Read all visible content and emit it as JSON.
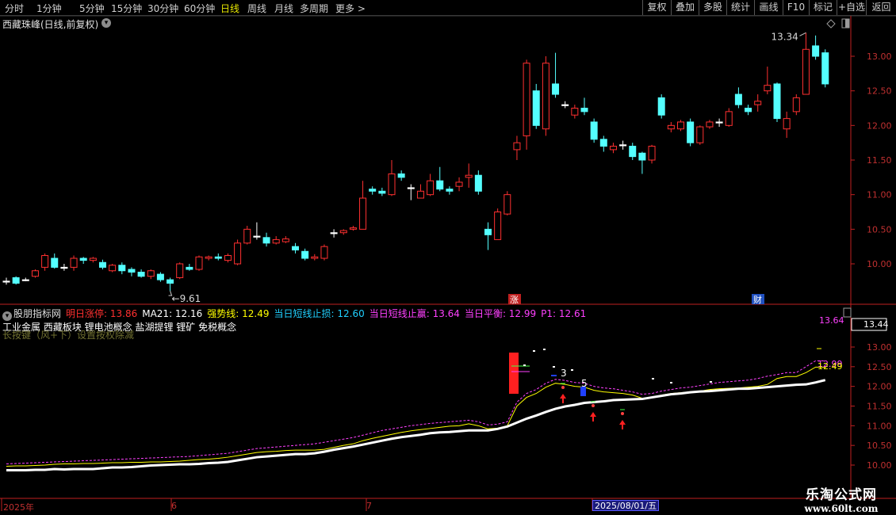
{
  "toolbar": {
    "periods": [
      "分时",
      "1分钟",
      "5分钟",
      "15分钟",
      "30分钟",
      "60分钟",
      "日线",
      "周线",
      "月线",
      "多周期",
      "更多 >"
    ],
    "active_period": "日线",
    "right_buttons": [
      "复权",
      "叠加",
      "多股",
      "统计",
      "画线",
      "F10",
      "标记",
      "+自选",
      "返回"
    ]
  },
  "main_panel": {
    "title": "西藏珠峰(日线,前复权)",
    "y_ticks": [
      "13.00",
      "12.50",
      "12.00",
      "11.50",
      "11.00",
      "10.50",
      "10.00"
    ],
    "high_label": "13.34",
    "low_label": "9.61",
    "event_badges": [
      {
        "text": "涨",
        "color": "#c02020"
      },
      {
        "text": "财",
        "color": "#2050c0"
      }
    ]
  },
  "indicator_panel": {
    "name": "股朋指标网",
    "items": [
      {
        "label": "明日涨停: 13.86",
        "color": "#ff3030"
      },
      {
        "label": "MA21: 12.16",
        "color": "#ffffff"
      },
      {
        "label": "强势线: 12.49",
        "color": "#ffff00"
      },
      {
        "label": "当日短线止损: 12.60",
        "color": "#20d0ff"
      },
      {
        "label": "当日短线止赢: 13.64",
        "color": "#ff40ff"
      },
      {
        "label": "当日平衡: 12.99",
        "color": "#ff40ff"
      },
      {
        "label": "P1: 12.61",
        "color": "#ff40ff"
      }
    ],
    "concept": "工业金属 西藏板块 锂电池概念 盐湖提锂 锂矿 免税概念",
    "ghost_text": "长按键（风+下）设置按权除减",
    "y_ticks": [
      "13.00",
      "12.50",
      "12.00",
      "11.50",
      "11.00",
      "10.50",
      "10.00"
    ],
    "right_labels": [
      {
        "text": "13.64",
        "color": "#ff40ff"
      },
      {
        "text": "13.44",
        "color": "#ffffff"
      },
      {
        "text": "12.99",
        "color": "#ff40ff"
      },
      {
        "text": "12.49",
        "color": "#ffff00"
      }
    ],
    "markers": [
      "3",
      "5"
    ]
  },
  "time_axis": {
    "labels": [
      "2025年",
      "6",
      "7"
    ],
    "cursor_date": "2025/08/01/五"
  },
  "watermark": {
    "title": "乐淘公式网",
    "url": "www.60lt.com"
  },
  "colors": {
    "up": "#ff3030",
    "down": "#54ffff",
    "axis": "#c02020",
    "ma": "#ffffff",
    "strong_line": "#ffff00",
    "upper_band": "#ff40ff"
  },
  "chart_data": {
    "type": "candlestick",
    "price_range": [
      9.61,
      13.34
    ],
    "ylim_main": [
      9.7,
      13.2
    ],
    "ylim_indicator": [
      9.9,
      13.2
    ],
    "x_labels": [
      "2025年",
      "6",
      "7",
      "2025/08/01/五"
    ],
    "candles": [
      {
        "o": 9.75,
        "c": 9.75,
        "h": 9.8,
        "l": 9.7
      },
      {
        "o": 9.8,
        "c": 9.72,
        "h": 9.82,
        "l": 9.7
      },
      {
        "o": 9.77,
        "c": 9.77,
        "h": 9.8,
        "l": 9.75
      },
      {
        "o": 9.82,
        "c": 9.9,
        "h": 9.92,
        "l": 9.8
      },
      {
        "o": 9.95,
        "c": 10.12,
        "h": 10.15,
        "l": 9.9
      },
      {
        "o": 10.08,
        "c": 9.95,
        "h": 10.15,
        "l": 9.93
      },
      {
        "o": 9.95,
        "c": 9.95,
        "h": 10.0,
        "l": 9.9
      },
      {
        "o": 9.95,
        "c": 10.08,
        "h": 10.12,
        "l": 9.9
      },
      {
        "o": 10.08,
        "c": 10.05,
        "h": 10.1,
        "l": 10.0
      },
      {
        "o": 10.05,
        "c": 10.08,
        "h": 10.1,
        "l": 10.02
      },
      {
        "o": 10.02,
        "c": 9.95,
        "h": 10.06,
        "l": 9.92
      },
      {
        "o": 9.9,
        "c": 9.98,
        "h": 10.0,
        "l": 9.88
      },
      {
        "o": 9.98,
        "c": 9.9,
        "h": 10.02,
        "l": 9.85
      },
      {
        "o": 9.92,
        "c": 9.88,
        "h": 9.95,
        "l": 9.82
      },
      {
        "o": 9.88,
        "c": 9.82,
        "h": 9.92,
        "l": 9.8
      },
      {
        "o": 9.82,
        "c": 9.9,
        "h": 9.92,
        "l": 9.78
      },
      {
        "o": 9.85,
        "c": 9.77,
        "h": 9.88,
        "l": 9.74
      },
      {
        "o": 9.77,
        "c": 9.72,
        "h": 9.8,
        "l": 9.61
      },
      {
        "o": 9.8,
        "c": 10.0,
        "h": 10.02,
        "l": 9.78
      },
      {
        "o": 9.95,
        "c": 9.92,
        "h": 10.0,
        "l": 9.9
      },
      {
        "o": 9.92,
        "c": 10.1,
        "h": 10.12,
        "l": 9.9
      },
      {
        "o": 10.08,
        "c": 10.1,
        "h": 10.12,
        "l": 10.05
      },
      {
        "o": 10.1,
        "c": 10.08,
        "h": 10.15,
        "l": 10.05
      },
      {
        "o": 10.05,
        "c": 10.12,
        "h": 10.15,
        "l": 10.02
      },
      {
        "o": 10.0,
        "c": 10.3,
        "h": 10.35,
        "l": 9.98
      },
      {
        "o": 10.3,
        "c": 10.5,
        "h": 10.55,
        "l": 10.28
      },
      {
        "o": 10.4,
        "c": 10.4,
        "h": 10.6,
        "l": 10.35
      },
      {
        "o": 10.38,
        "c": 10.3,
        "h": 10.45,
        "l": 10.25
      },
      {
        "o": 10.3,
        "c": 10.35,
        "h": 10.4,
        "l": 10.28
      },
      {
        "o": 10.32,
        "c": 10.36,
        "h": 10.4,
        "l": 10.3
      },
      {
        "o": 10.25,
        "c": 10.2,
        "h": 10.3,
        "l": 10.15
      },
      {
        "o": 10.18,
        "c": 10.08,
        "h": 10.22,
        "l": 10.05
      },
      {
        "o": 10.08,
        "c": 10.1,
        "h": 10.14,
        "l": 10.05
      },
      {
        "o": 10.08,
        "c": 10.25,
        "h": 10.28,
        "l": 10.05
      },
      {
        "o": 10.45,
        "c": 10.45,
        "h": 10.5,
        "l": 10.38
      },
      {
        "o": 10.45,
        "c": 10.48,
        "h": 10.5,
        "l": 10.42
      },
      {
        "o": 10.5,
        "c": 10.52,
        "h": 10.55,
        "l": 10.48
      },
      {
        "o": 10.5,
        "c": 10.95,
        "h": 11.2,
        "l": 10.5
      },
      {
        "o": 11.08,
        "c": 11.05,
        "h": 11.12,
        "l": 11.0
      },
      {
        "o": 11.05,
        "c": 11.02,
        "h": 11.1,
        "l": 10.98
      },
      {
        "o": 11.0,
        "c": 11.3,
        "h": 11.5,
        "l": 10.98
      },
      {
        "o": 11.3,
        "c": 11.25,
        "h": 11.35,
        "l": 11.2
      },
      {
        "o": 11.1,
        "c": 11.1,
        "h": 11.15,
        "l": 10.92
      },
      {
        "o": 10.95,
        "c": 11.05,
        "h": 11.15,
        "l": 10.95
      },
      {
        "o": 11.0,
        "c": 11.2,
        "h": 11.3,
        "l": 10.98
      },
      {
        "o": 11.2,
        "c": 11.08,
        "h": 11.4,
        "l": 11.05
      },
      {
        "o": 11.08,
        "c": 11.05,
        "h": 11.12,
        "l": 11.0
      },
      {
        "o": 11.12,
        "c": 11.18,
        "h": 11.25,
        "l": 11.05
      },
      {
        "o": 11.25,
        "c": 11.28,
        "h": 11.45,
        "l": 11.1
      },
      {
        "o": 11.28,
        "c": 11.05,
        "h": 11.35,
        "l": 11.0
      },
      {
        "o": 10.5,
        "c": 10.42,
        "h": 10.6,
        "l": 10.2
      },
      {
        "o": 10.35,
        "c": 10.75,
        "h": 10.8,
        "l": 10.35
      },
      {
        "o": 10.72,
        "c": 11.0,
        "h": 11.05,
        "l": 10.7
      },
      {
        "o": 11.65,
        "c": 11.75,
        "h": 11.85,
        "l": 11.5
      },
      {
        "o": 11.85,
        "c": 12.9,
        "h": 12.95,
        "l": 11.65
      },
      {
        "o": 12.5,
        "c": 12.0,
        "h": 12.6,
        "l": 11.95
      },
      {
        "o": 11.95,
        "c": 12.9,
        "h": 13.0,
        "l": 11.85
      },
      {
        "o": 12.6,
        "c": 12.45,
        "h": 13.05,
        "l": 12.4
      },
      {
        "o": 12.3,
        "c": 12.3,
        "h": 12.35,
        "l": 12.25
      },
      {
        "o": 12.15,
        "c": 12.25,
        "h": 12.3,
        "l": 12.1
      },
      {
        "o": 12.25,
        "c": 12.2,
        "h": 12.4,
        "l": 12.15
      },
      {
        "o": 12.05,
        "c": 11.8,
        "h": 12.1,
        "l": 11.75
      },
      {
        "o": 11.8,
        "c": 11.7,
        "h": 11.85,
        "l": 11.62
      },
      {
        "o": 11.65,
        "c": 11.7,
        "h": 11.75,
        "l": 11.6
      },
      {
        "o": 11.72,
        "c": 11.72,
        "h": 11.78,
        "l": 11.65
      },
      {
        "o": 11.7,
        "c": 11.55,
        "h": 11.75,
        "l": 11.5
      },
      {
        "o": 11.6,
        "c": 11.5,
        "h": 11.62,
        "l": 11.3
      },
      {
        "o": 11.5,
        "c": 11.7,
        "h": 11.72,
        "l": 11.45
      },
      {
        "o": 12.4,
        "c": 12.15,
        "h": 12.45,
        "l": 12.1
      },
      {
        "o": 11.95,
        "c": 12.0,
        "h": 12.05,
        "l": 11.9
      },
      {
        "o": 11.95,
        "c": 12.05,
        "h": 12.08,
        "l": 11.92
      },
      {
        "o": 12.05,
        "c": 11.75,
        "h": 12.1,
        "l": 11.7
      },
      {
        "o": 11.75,
        "c": 11.98,
        "h": 12.0,
        "l": 11.72
      },
      {
        "o": 11.98,
        "c": 12.05,
        "h": 12.08,
        "l": 11.95
      },
      {
        "o": 12.05,
        "c": 12.05,
        "h": 12.1,
        "l": 11.98
      },
      {
        "o": 12.0,
        "c": 12.2,
        "h": 12.25,
        "l": 11.98
      },
      {
        "o": 12.45,
        "c": 12.3,
        "h": 12.55,
        "l": 12.25
      },
      {
        "o": 12.25,
        "c": 12.2,
        "h": 12.3,
        "l": 12.15
      },
      {
        "o": 12.3,
        "c": 12.35,
        "h": 12.45,
        "l": 12.2
      },
      {
        "o": 12.5,
        "c": 12.58,
        "h": 12.85,
        "l": 12.45
      },
      {
        "o": 12.6,
        "c": 12.1,
        "h": 12.62,
        "l": 12.05
      },
      {
        "o": 11.95,
        "c": 12.1,
        "h": 12.2,
        "l": 11.82
      },
      {
        "o": 12.2,
        "c": 12.4,
        "h": 12.45,
        "l": 12.15
      },
      {
        "o": 12.45,
        "c": 13.1,
        "h": 13.34,
        "l": 12.45
      },
      {
        "o": 13.15,
        "c": 13.0,
        "h": 13.3,
        "l": 12.95
      },
      {
        "o": 13.05,
        "c": 12.6,
        "h": 13.1,
        "l": 12.55
      }
    ],
    "ma21": [
      9.87,
      9.87,
      9.87,
      9.88,
      9.88,
      9.9,
      9.89,
      9.9,
      9.9,
      9.9,
      9.92,
      9.94,
      9.94,
      9.95,
      9.97,
      9.99,
      10.0,
      10.01,
      10.02,
      10.02,
      10.03,
      10.05,
      10.06,
      10.08,
      10.12,
      10.16,
      10.2,
      10.22,
      10.24,
      10.26,
      10.28,
      10.28,
      10.3,
      10.34,
      10.39,
      10.43,
      10.47,
      10.52,
      10.57,
      10.62,
      10.67,
      10.71,
      10.74,
      10.77,
      10.81,
      10.83,
      10.84,
      10.86,
      10.88,
      10.88,
      10.88,
      10.92,
      10.98,
      11.08,
      11.18,
      11.26,
      11.35,
      11.43,
      11.49,
      11.53,
      11.58,
      11.6,
      11.62,
      11.65,
      11.66,
      11.67,
      11.68,
      11.72,
      11.76,
      11.8,
      11.82,
      11.85,
      11.87,
      11.88,
      11.9,
      11.92,
      11.94,
      11.94,
      11.96,
      11.98,
      12.0,
      12.02,
      12.04,
      12.05,
      12.1,
      12.16
    ],
    "strong_line": [
      9.97,
      9.98,
      9.98,
      9.99,
      10.0,
      10.02,
      10.03,
      10.03,
      10.04,
      10.04,
      10.05,
      10.06,
      10.06,
      10.07,
      10.07,
      10.08,
      10.08,
      10.09,
      10.1,
      10.12,
      10.14,
      10.15,
      10.17,
      10.2,
      10.24,
      10.28,
      10.32,
      10.34,
      10.35,
      10.37,
      10.38,
      10.38,
      10.38,
      10.4,
      10.45,
      10.5,
      10.54,
      10.62,
      10.68,
      10.73,
      10.78,
      10.83,
      10.87,
      10.9,
      10.93,
      10.96,
      10.99,
      11.0,
      11.05,
      11.0,
      10.92,
      10.94,
      11.0,
      11.5,
      11.72,
      11.82,
      11.98,
      12.08,
      12.05,
      12.0,
      11.98,
      11.9,
      11.86,
      11.84,
      11.82,
      11.78,
      11.7,
      11.72,
      11.78,
      11.82,
      11.84,
      11.86,
      11.88,
      11.92,
      11.94,
      11.95,
      11.96,
      11.98,
      12.0,
      12.05,
      12.2,
      12.25,
      12.25,
      12.35,
      12.49,
      12.49
    ],
    "upper_band": [
      10.03,
      10.04,
      10.05,
      10.06,
      10.07,
      10.08,
      10.09,
      10.1,
      10.11,
      10.12,
      10.13,
      10.14,
      10.15,
      10.16,
      10.17,
      10.18,
      10.19,
      10.2,
      10.21,
      10.22,
      10.24,
      10.26,
      10.28,
      10.3,
      10.34,
      10.38,
      10.42,
      10.44,
      10.46,
      10.48,
      10.5,
      10.52,
      10.54,
      10.58,
      10.62,
      10.66,
      10.7,
      10.76,
      10.82,
      10.88,
      10.92,
      10.96,
      11.0,
      11.03,
      11.06,
      11.08,
      11.1,
      11.12,
      11.14,
      11.1,
      11.02,
      11.04,
      11.1,
      11.6,
      11.82,
      11.92,
      12.08,
      12.18,
      12.15,
      12.1,
      12.08,
      12.0,
      11.96,
      11.94,
      11.9,
      11.86,
      11.8,
      11.82,
      11.88,
      11.92,
      11.96,
      11.98,
      12.02,
      12.06,
      12.1,
      12.12,
      12.14,
      12.16,
      12.2,
      12.26,
      12.3,
      12.35,
      12.35,
      12.5,
      12.65,
      12.65
    ]
  }
}
